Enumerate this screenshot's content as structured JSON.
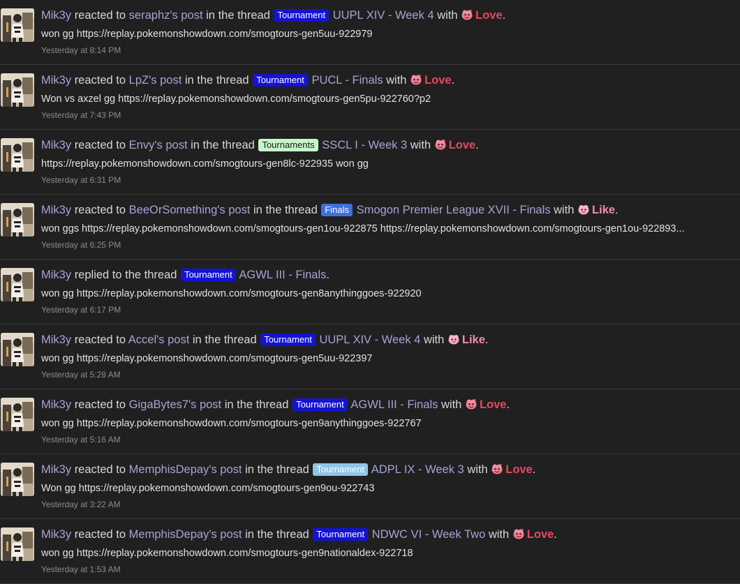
{
  "common": {
    "user": "Mik3y",
    "reacted_to": "reacted to",
    "post_suffix": "'s post",
    "in_the_thread": "in the thread",
    "with": "with",
    "period": ".",
    "replied_to_the_thread": "replied to the thread"
  },
  "colors": {
    "love": "#e8475f",
    "like": "#f08ab4",
    "tournament_badge_bg": "#1313d1",
    "tournament_badge_fg": "#ffffff",
    "tournaments_badge_bg": "#c8f5c8",
    "tournaments_badge_fg": "#1a1a1a",
    "finals_badge_bg": "#3f6fd9",
    "finals_badge_fg": "#ffffff",
    "tournament_light_bg": "#8fc6e6",
    "tournament_light_fg": "#ffffff"
  },
  "items": [
    {
      "kind": "reaction",
      "poster": "seraphz",
      "badge": {
        "label": "Tournament",
        "style": "blue"
      },
      "thread": "UUPL XIV - Week 4",
      "reaction": {
        "label": "Love",
        "icon": "love-icon"
      },
      "snippet": "won gg https://replay.pokemonshowdown.com/smogtours-gen5uu-922979",
      "time": "Yesterday at 8:14 PM"
    },
    {
      "kind": "reaction",
      "poster": "LpZ",
      "badge": {
        "label": "Tournament",
        "style": "blue"
      },
      "thread": "PUCL - Finals",
      "reaction": {
        "label": "Love",
        "icon": "love-icon"
      },
      "snippet": "Won vs axzel gg https://replay.pokemonshowdown.com/smogtours-gen5pu-922760?p2",
      "time": "Yesterday at 7:43 PM"
    },
    {
      "kind": "reaction",
      "poster": "Envy",
      "badge": {
        "label": "Tournaments",
        "style": "green"
      },
      "thread": "SSCL I - Week 3",
      "reaction": {
        "label": "Love",
        "icon": "love-icon"
      },
      "snippet": "https://replay.pokemonshowdown.com/smogtours-gen8lc-922935 won gg",
      "time": "Yesterday at 6:31 PM"
    },
    {
      "kind": "reaction",
      "poster": "BeeOrSomething",
      "badge": {
        "label": "Finals",
        "style": "finals"
      },
      "thread": "Smogon Premier League XVII - Finals",
      "reaction": {
        "label": "Like",
        "icon": "like-icon"
      },
      "snippet": "won ggs https://replay.pokemonshowdown.com/smogtours-gen1ou-922875 https://replay.pokemonshowdown.com/smogtours-gen1ou-922893...",
      "time": "Yesterday at 6:25 PM"
    },
    {
      "kind": "reply",
      "badge": {
        "label": "Tournament",
        "style": "blue"
      },
      "thread": "AGWL III - Finals",
      "snippet": "won gg https://replay.pokemonshowdown.com/smogtours-gen8anythinggoes-922920",
      "time": "Yesterday at 6:17 PM"
    },
    {
      "kind": "reaction",
      "poster": "Accel",
      "badge": {
        "label": "Tournament",
        "style": "blue"
      },
      "thread": "UUPL XIV - Week 4",
      "reaction": {
        "label": "Like",
        "icon": "like-icon"
      },
      "snippet": "won gg https://replay.pokemonshowdown.com/smogtours-gen5uu-922397",
      "time": "Yesterday at 5:28 AM"
    },
    {
      "kind": "reaction",
      "poster": "GigaBytes7",
      "badge": {
        "label": "Tournament",
        "style": "blue"
      },
      "thread": "AGWL III - Finals",
      "reaction": {
        "label": "Love",
        "icon": "love-icon"
      },
      "snippet": "won gg https://replay.pokemonshowdown.com/smogtours-gen9anythinggoes-922767",
      "time": "Yesterday at 5:16 AM"
    },
    {
      "kind": "reaction",
      "poster": "MemphisDepay",
      "badge": {
        "label": "Tournament",
        "style": "light"
      },
      "thread": "ADPL IX - Week 3",
      "reaction": {
        "label": "Love",
        "icon": "love-icon"
      },
      "snippet": "Won gg https://replay.pokemonshowdown.com/smogtours-gen9ou-922743",
      "time": "Yesterday at 3:22 AM"
    },
    {
      "kind": "reaction",
      "poster": "MemphisDepay",
      "badge": {
        "label": "Tournament",
        "style": "blue"
      },
      "thread": "NDWC VI - Week Two",
      "reaction": {
        "label": "Love",
        "icon": "love-icon"
      },
      "snippet": "won gg https://replay.pokemonshowdown.com/smogtours-gen9nationaldex-922718",
      "time": "Yesterday at 1:53 AM"
    }
  ]
}
